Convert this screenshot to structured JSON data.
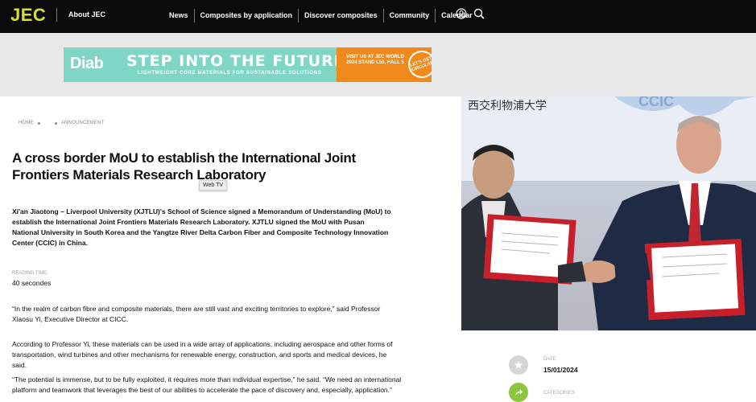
{
  "nav": {
    "logo": "JEC",
    "about": "About JEC",
    "items": [
      "News",
      "Composites by application",
      "Discover composites",
      "Community",
      "Calendar"
    ],
    "icons": [
      "user-icon",
      "search-icon"
    ]
  },
  "banner": {
    "brand": "Diab",
    "title": "STEP INTO THE FUTURE",
    "subtitle": "LIGHTWEIGHT CORE MATERIALS FOR SUSTAINABLE SOLUTIONS",
    "cta": "VISIT US AT JEC WORLD 2024 STAND L50, HALL 5",
    "badge": "LET'S GET CIRCULAR",
    "colors": {
      "background": "#7fd6c7",
      "cta": "#f08a1c"
    }
  },
  "breadcrumb": [
    "HOME",
    "ANNOUNCEMENT"
  ],
  "article": {
    "title": "A cross border MoU to establish the International Joint Frontiers Materials Research Laboratory",
    "tooltip": "Web TV",
    "lead": "Xi'an Jiaotong – Liverpool University (XJTLU)'s School of Science signed a Memorandum of Understanding (MoU) to establish the International Joint Frontiers Materials Research Laboratory. XJTLU signed the MoU with Pusan National University in South Korea and the Yangtze River Delta Carbon Fiber and Composite Technology Innovation Center (CCIC) in China.",
    "reading_time_label": "READING TIME",
    "reading_time": "40 secondes",
    "paragraphs": [
      "“In the realm of carbon fibre and composite materials, there are still vast and exciting territories to explore,” said Professor Xiaosu Yi, Executive Director at CICC.",
      "According to Professor Yi, these materials can be used in a wide array of applications, including aerospace and other forms of transportation, wind turbines and other mechanisms for renewable energy, construction, and sports and medical devices, he said.",
      "“The potential is immense, but to be fully exploited, it requires more than individual expertise,” he said. “We need an international platform and teamwork that leverages the best of our abilities to accelerate the pace of discovery and, especially, application.”"
    ]
  },
  "photo": {
    "sign_text": "西交利物浦大学",
    "logo_text": "CCIC"
  },
  "sidebar": {
    "date_label": "DATE",
    "date": "15/01/2024",
    "categories_label": "CATEGORIES",
    "accent": "#8cc63f"
  }
}
